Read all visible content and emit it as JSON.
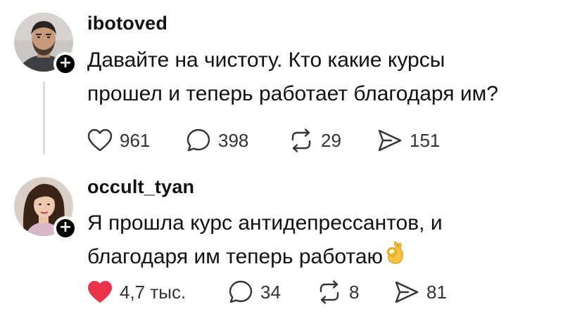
{
  "posts": [
    {
      "username": "ibotoved",
      "text_line1": "Давайте на чистоту. Кто какие курсы",
      "text_line2": "прошел и теперь работает благодаря им?",
      "likes": "961",
      "comments": "398",
      "reposts": "29",
      "shares": "151",
      "liked": false
    },
    {
      "username": "occult_tyan",
      "text_line1": "Я прошла курс антидепрессантов, и",
      "text_line2": "благодаря им теперь работаю",
      "likes": "4,7 тыс.",
      "comments": "34",
      "reposts": "8",
      "shares": "81",
      "liked": true
    }
  ],
  "colors": {
    "like_active": "#e8334a",
    "icon_gray": "#333333",
    "thread_line": "#dcdcdc"
  },
  "icons": {
    "follow": "plus-icon",
    "like": "heart-icon",
    "comment": "comment-bubble-icon",
    "repost": "repost-icon",
    "share": "send-icon",
    "emoji": "ok-hand-emoji"
  },
  "follow_symbol": "+"
}
